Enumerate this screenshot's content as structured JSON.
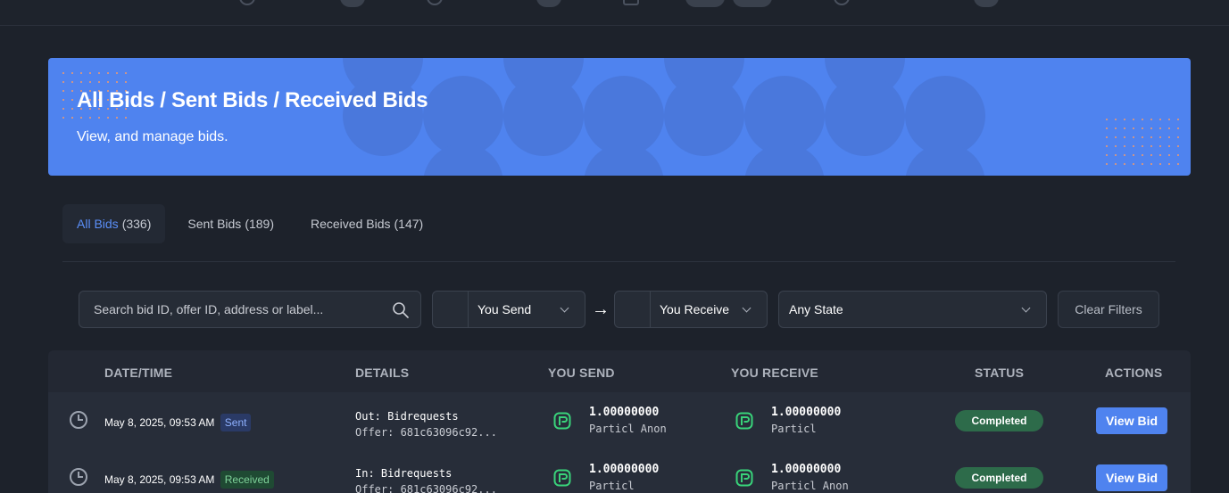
{
  "hero": {
    "title": "All Bids / Sent Bids / Received Bids",
    "subtitle": "View, and manage bids."
  },
  "tabs": [
    {
      "label": "All Bids",
      "count": "(336)",
      "active": true
    },
    {
      "label": "Sent Bids",
      "count": "(189)",
      "active": false
    },
    {
      "label": "Received Bids",
      "count": "(147)",
      "active": false
    }
  ],
  "filters": {
    "search_placeholder": "Search bid ID, offer ID, address or label...",
    "you_send": "You Send",
    "arrow": "→",
    "you_receive": "You Receive",
    "state": "Any State",
    "clear": "Clear Filters"
  },
  "table": {
    "headers": {
      "datetime": "DATE/TIME",
      "details": "DETAILS",
      "you_send": "YOU SEND",
      "you_receive": "YOU RECEIVE",
      "status": "STATUS",
      "actions": "ACTIONS"
    },
    "rows": [
      {
        "datetime": "May 8, 2025, 09:53 AM",
        "direction": "Sent",
        "details_line": "Out: Bidrequests",
        "offer": "Offer: 681c63096c92...",
        "send_amount": "1.00000000",
        "send_coin": "Particl Anon",
        "receive_amount": "1.00000000",
        "receive_coin": "Particl",
        "status": "Completed",
        "action": "View Bid"
      },
      {
        "datetime": "May 8, 2025, 09:53 AM",
        "direction": "Received",
        "details_line": "In: Bidrequests",
        "offer": "Offer: 681c63096c92...",
        "send_amount": "1.00000000",
        "send_coin": "Particl",
        "receive_amount": "1.00000000",
        "receive_coin": "Particl Anon",
        "status": "Completed",
        "action": "View Bid"
      }
    ]
  },
  "colors": {
    "accent": "#4f83ef",
    "completed": "#2d6b4a",
    "particl": "#39d37a"
  }
}
